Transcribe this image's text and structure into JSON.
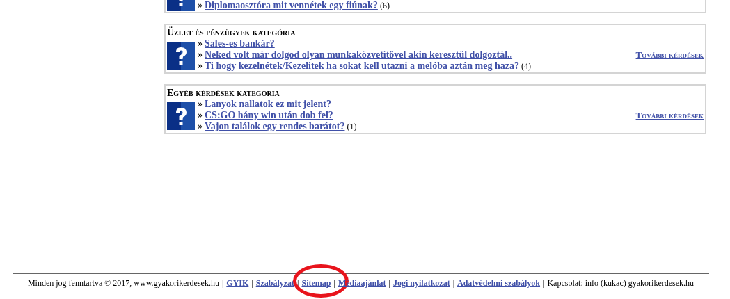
{
  "categories": [
    {
      "partial": true,
      "questions": [
        {
          "bullet": "»",
          "text": "Diplomaosztóra mit vennétek egy fiúnak?",
          "count": "(6)"
        }
      ]
    },
    {
      "partial": false,
      "title": "Üzlet és pénzügyek kategória",
      "more": "További kérdések",
      "questions": [
        {
          "bullet": "»",
          "text": "Sales-es bankár?"
        },
        {
          "bullet": "»",
          "text": "Neked volt már dolgod olyan munkaközvetítővel akin keresztül dolgoztál.."
        },
        {
          "bullet": "»",
          "text": "Ti hogy kezelnétek/Kezelitek ha sokat kell utazni a melóba aztán meg haza?",
          "count": "(4)"
        }
      ]
    },
    {
      "partial": false,
      "title": "Egyéb kérdések kategória",
      "more": "További kérdések",
      "questions": [
        {
          "bullet": "»",
          "text": "Lanyok nallatok ez mit jelent?"
        },
        {
          "bullet": "»",
          "text": "CS:GO hány win után dob fel?"
        },
        {
          "bullet": "»",
          "text": "Vajon találok egy rendes barátot?",
          "count": "(1)"
        }
      ]
    }
  ],
  "footer": {
    "copyright": "Minden jog fenntartva © 2017, www.gyakorikerdesek.hu",
    "links": [
      {
        "separator": "|",
        "label": "GYIK",
        "circled": false
      },
      {
        "separator": "|",
        "label": "Szabályzat",
        "circled": false
      },
      {
        "separator": "|",
        "label": "Sitemap",
        "circled": true
      },
      {
        "separator": "|",
        "label": "Médiaajánlat",
        "circled": false
      },
      {
        "separator": "|",
        "label": "Jogi nyilatkozat",
        "circled": false
      },
      {
        "separator": "|",
        "label": "Adatvédelmi szabályok",
        "circled": false
      }
    ],
    "contact_separator": "|",
    "contact": "Kapcsolat: info (kukac) gyakorikerdesek.hu"
  }
}
